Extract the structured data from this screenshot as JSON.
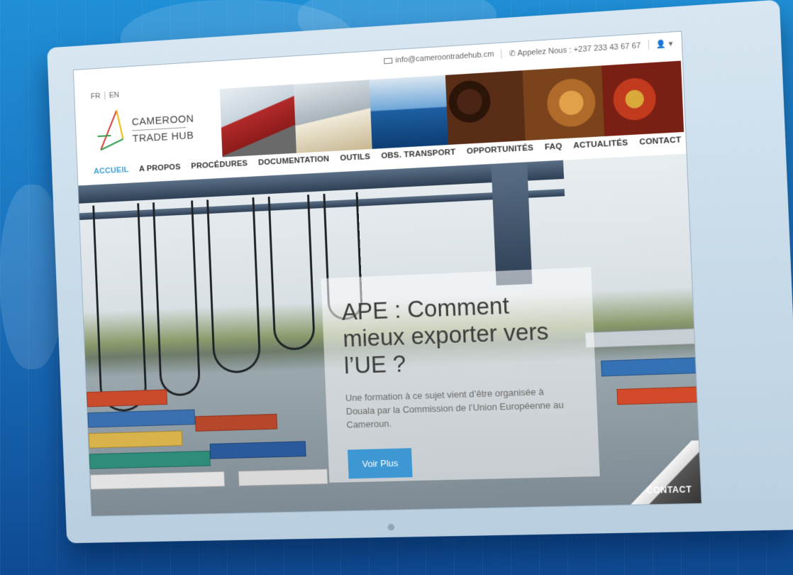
{
  "topbar": {
    "email": "info@cameroontradehub.cm",
    "phone": "Appelez Nous : +237 233 43 67 67",
    "user_icon": "user-icon"
  },
  "languages": [
    "FR",
    "EN"
  ],
  "logo": {
    "line1": "CAMEROON",
    "line2": "TRADE HUB"
  },
  "nav": [
    {
      "label": "ACCUEIL",
      "active": true
    },
    {
      "label": "A PROPOS"
    },
    {
      "label": "PROCÉDURES"
    },
    {
      "label": "DOCUMENTATION"
    },
    {
      "label": "OUTILS"
    },
    {
      "label": "OBS. TRANSPORT"
    },
    {
      "label": "OPPORTUNITÉS"
    },
    {
      "label": "FAQ"
    },
    {
      "label": "ACTUALITÉS"
    },
    {
      "label": "CONTACT"
    }
  ],
  "hero": {
    "title": "APE : Comment mieux exporter vers l’UE ?",
    "text": "Une formation à ce sujet vient d’être organisée à Douala par la Commission de l’Union Européenne au Cameroun.",
    "button": "Voir Plus"
  },
  "corner": {
    "label": "CONTACT"
  },
  "colors": {
    "accent": "#3d97d3",
    "nav_active": "#3aa0d6",
    "background": "#1b73bf"
  }
}
